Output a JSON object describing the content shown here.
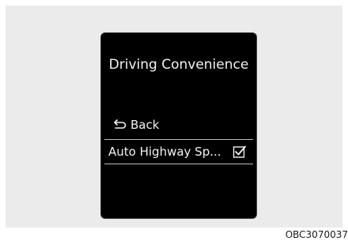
{
  "screen": {
    "title": "Driving Convenience",
    "back_label": "Back",
    "items": [
      {
        "label": "Auto Highway Sp...",
        "checked": true
      }
    ]
  },
  "caption": "OBC3070037",
  "icons": {
    "back": "back-arrow-icon",
    "check": "checkbox-checked-icon"
  },
  "colors": {
    "screen_bg": "#000000",
    "panel_bg": "#ebebeb",
    "text": "#f2f2f2",
    "divider": "#bdbdbd"
  }
}
